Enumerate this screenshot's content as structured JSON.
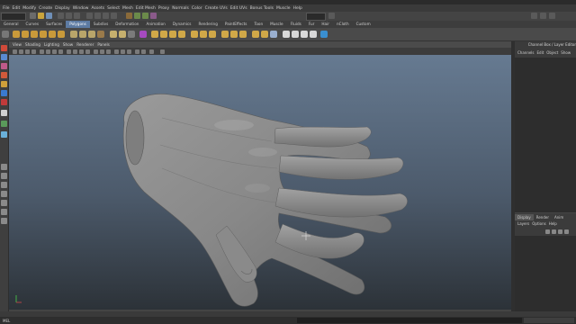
{
  "menubar": {
    "items": [
      "File",
      "Edit",
      "Modify",
      "Create",
      "Display",
      "Window",
      "Assets",
      "Select",
      "Mesh",
      "Edit Mesh",
      "Proxy",
      "Normals",
      "Color",
      "Create UVs",
      "Edit UVs",
      "Bonus Tools",
      "Muscle",
      "Help"
    ]
  },
  "statusline": {
    "mode_value": "Polygons"
  },
  "shelf": {
    "tabs": [
      "General",
      "Curves",
      "Surfaces",
      "Polygons",
      "Subdivs",
      "Deformation",
      "Animation",
      "Dynamics",
      "Rendering",
      "PaintEffects",
      "Toon",
      "Muscle",
      "Fluids",
      "Fur",
      "Hair",
      "nCloth",
      "Custom"
    ],
    "active_tab": "Polygons"
  },
  "viewport": {
    "menu": [
      "View",
      "Shading",
      "Lighting",
      "Show",
      "Renderer",
      "Panels"
    ]
  },
  "channel_box": {
    "title": "Channel Box / Layer Editor",
    "menu": [
      "Channels",
      "Edit",
      "Object",
      "Show"
    ]
  },
  "layer_editor": {
    "tabs": [
      "Display",
      "Render",
      "Anim"
    ],
    "active_tab": "Display",
    "menu": [
      "Layers",
      "Options",
      "Help"
    ]
  },
  "command_line": {
    "label": "MEL"
  },
  "colors": {
    "accent": "#5d7ba3",
    "viewport_top": "#667a91",
    "viewport_bottom": "#2c3238",
    "mesh": "#8c8c8c"
  }
}
